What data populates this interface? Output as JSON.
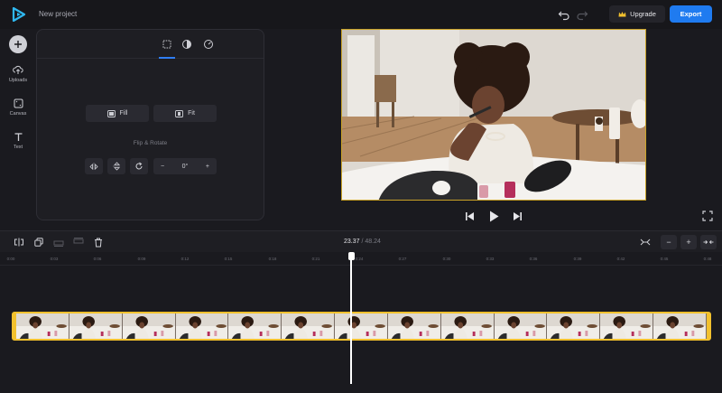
{
  "app": {
    "project_title": "New project"
  },
  "toolbar": {
    "upgrade_label": "Upgrade",
    "export_label": "Export"
  },
  "sidebar": {
    "items": [
      {
        "label": "Uploads",
        "icon": "upload-icon"
      },
      {
        "label": "Canvas",
        "icon": "canvas-icon"
      },
      {
        "label": "Text",
        "icon": "text-icon"
      }
    ]
  },
  "panel": {
    "fill_label": "Fill",
    "fit_label": "Fit",
    "flip_rotate_label": "Flip & Rotate",
    "rotation_value": "0°"
  },
  "timeline": {
    "current_time": "23.37",
    "total_time": "/ 48.24",
    "ticks": [
      "0:00",
      "0:03",
      "0:06",
      "0:09",
      "0:12",
      "0:15",
      "0:18",
      "0:21",
      "0:24",
      "0:27",
      "0:30",
      "0:33",
      "0:36",
      "0:39",
      "0:42",
      "0:45",
      "0:48"
    ]
  },
  "colors": {
    "accent": "#1f7bf0",
    "clip_border": "#f2c12e",
    "playhead": "#ffffff"
  }
}
